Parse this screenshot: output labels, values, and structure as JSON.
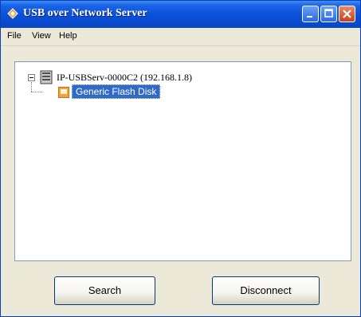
{
  "window": {
    "title": "USB over Network Server",
    "icons": {
      "app": "diamond-app-icon",
      "minimize": "minimize-icon",
      "maximize": "maximize-icon",
      "close": "close-icon"
    },
    "colors": {
      "titlebar": "#0b4fd8",
      "selection": "#316ac5",
      "close_button": "#c8401e"
    }
  },
  "menu": {
    "items": [
      {
        "label": "File"
      },
      {
        "label": "View"
      },
      {
        "label": "Help"
      }
    ]
  },
  "tree": {
    "server": {
      "label": "IP-USBServ-0000C2 (192.168.1.8)",
      "icon": "server-icon",
      "expanded": true
    },
    "devices": [
      {
        "label": "Generic Flash Disk",
        "icon": "usb-device-icon",
        "selected": true
      }
    ]
  },
  "buttons": {
    "search_label": "Search",
    "disconnect_label": "Disconnect"
  }
}
